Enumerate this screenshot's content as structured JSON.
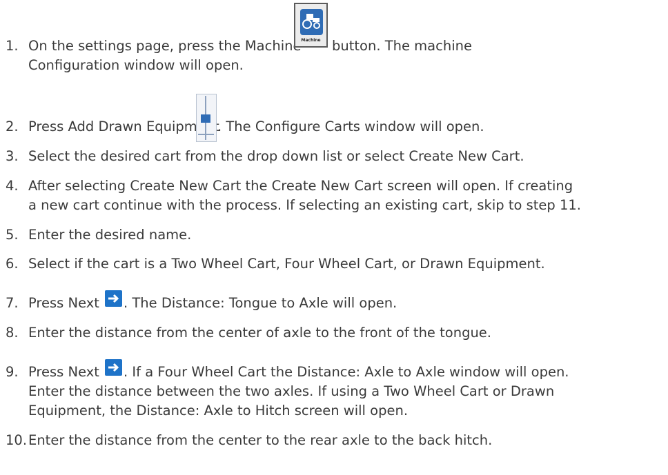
{
  "icons": {
    "machine_label": "Machine"
  },
  "steps": [
    {
      "num": "1.",
      "lines": [
        "On the settings page, press the Machine",
        "Configuration window will open."
      ],
      "after_icon": "button. The machine"
    },
    {
      "num": "2.",
      "text_before": "Press Add Drawn Equipment",
      "text_after": ". The Configure Carts window will open."
    },
    {
      "num": "3.",
      "text": "Select the desired cart from the drop down list or select Create New Cart."
    },
    {
      "num": "4.",
      "lines": [
        "After selecting Create New Cart the Create New Cart screen will open. If creating",
        "a new cart continue with the process. If selecting an existing cart, skip to step 11."
      ]
    },
    {
      "num": "5.",
      "text": "Enter the desired name."
    },
    {
      "num": "6.",
      "text": "Select if the cart is a Two Wheel Cart, Four Wheel Cart, or Drawn Equipment."
    },
    {
      "num": "7.",
      "text_before": "Press Next",
      "text_after": ". The Distance: Tongue to Axle will open."
    },
    {
      "num": "8.",
      "text": "Enter the distance from the center of axle to the front of the tongue."
    },
    {
      "num": "9.",
      "text_before": "Press Next",
      "text_after": ". If a Four Wheel Cart the Distance: Axle to Axle window will open.",
      "lines": [
        "Enter the distance between the two axles. If using a Two Wheel Cart or Drawn",
        "Equipment, the Distance: Axle to Hitch screen will open."
      ]
    },
    {
      "num": "10.",
      "text": "Enter the distance from the center to the rear axle to the back hitch."
    }
  ]
}
